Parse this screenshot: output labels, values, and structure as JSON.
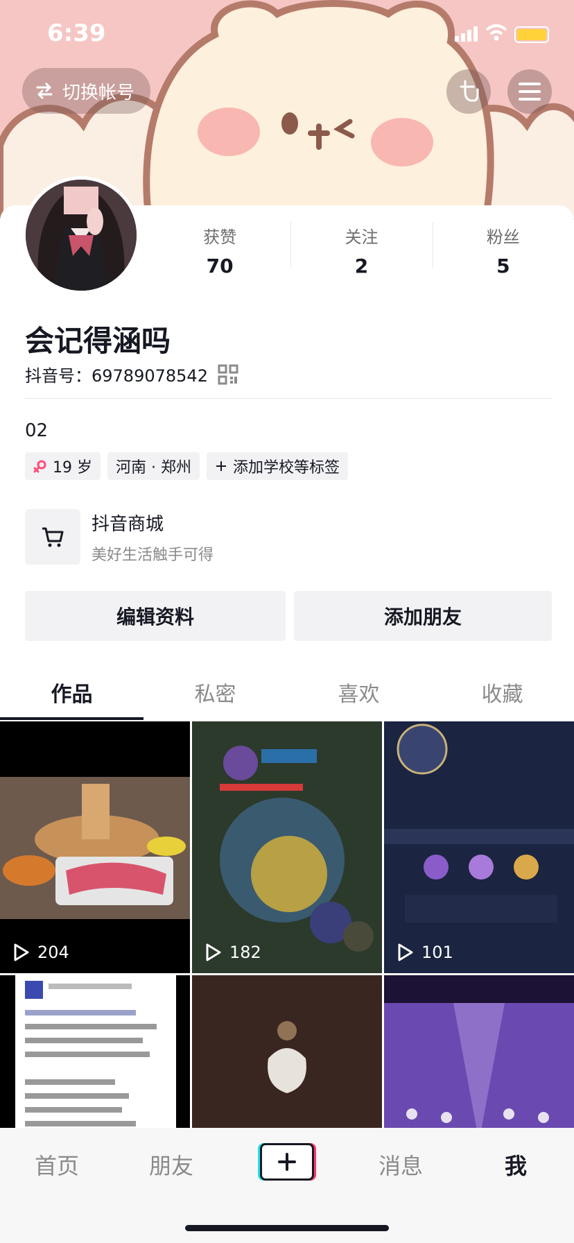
{
  "status_bar": {
    "time": "6:39"
  },
  "header": {
    "switch_account_label": "切换帐号"
  },
  "profile": {
    "stats": [
      {
        "label": "获赞",
        "value": "70"
      },
      {
        "label": "关注",
        "value": "2"
      },
      {
        "label": "粉丝",
        "value": "5"
      }
    ],
    "nickname": "会记得涵吗",
    "douyin_id": "抖音号：69789078542",
    "signature": "02",
    "tags": {
      "age": "19 岁",
      "location": "河南 · 郑州",
      "add_school": "添加学校等标签"
    }
  },
  "shop": {
    "title": "抖音商城",
    "subtitle": "美好生活触手可得"
  },
  "actions": {
    "edit_profile": "编辑资料",
    "add_friends": "添加朋友"
  },
  "tabs": [
    "作品",
    "私密",
    "喜欢",
    "收藏"
  ],
  "videos": [
    {
      "play_count": "204"
    },
    {
      "play_count": "182"
    },
    {
      "play_count": "101"
    }
  ],
  "bottom_nav": {
    "home": "首页",
    "friends": "朋友",
    "messages": "消息",
    "me": "我"
  },
  "colors": {
    "banner_bg": "#f5c6c3",
    "text_primary": "#161823",
    "age_tag_icon": "#ff4d77"
  },
  "icons": [
    "switch-arrows-icon",
    "hand-pointer-icon",
    "menu-icon",
    "qr-code-icon",
    "female-icon",
    "plus-icon",
    "cart-icon",
    "play-icon"
  ]
}
